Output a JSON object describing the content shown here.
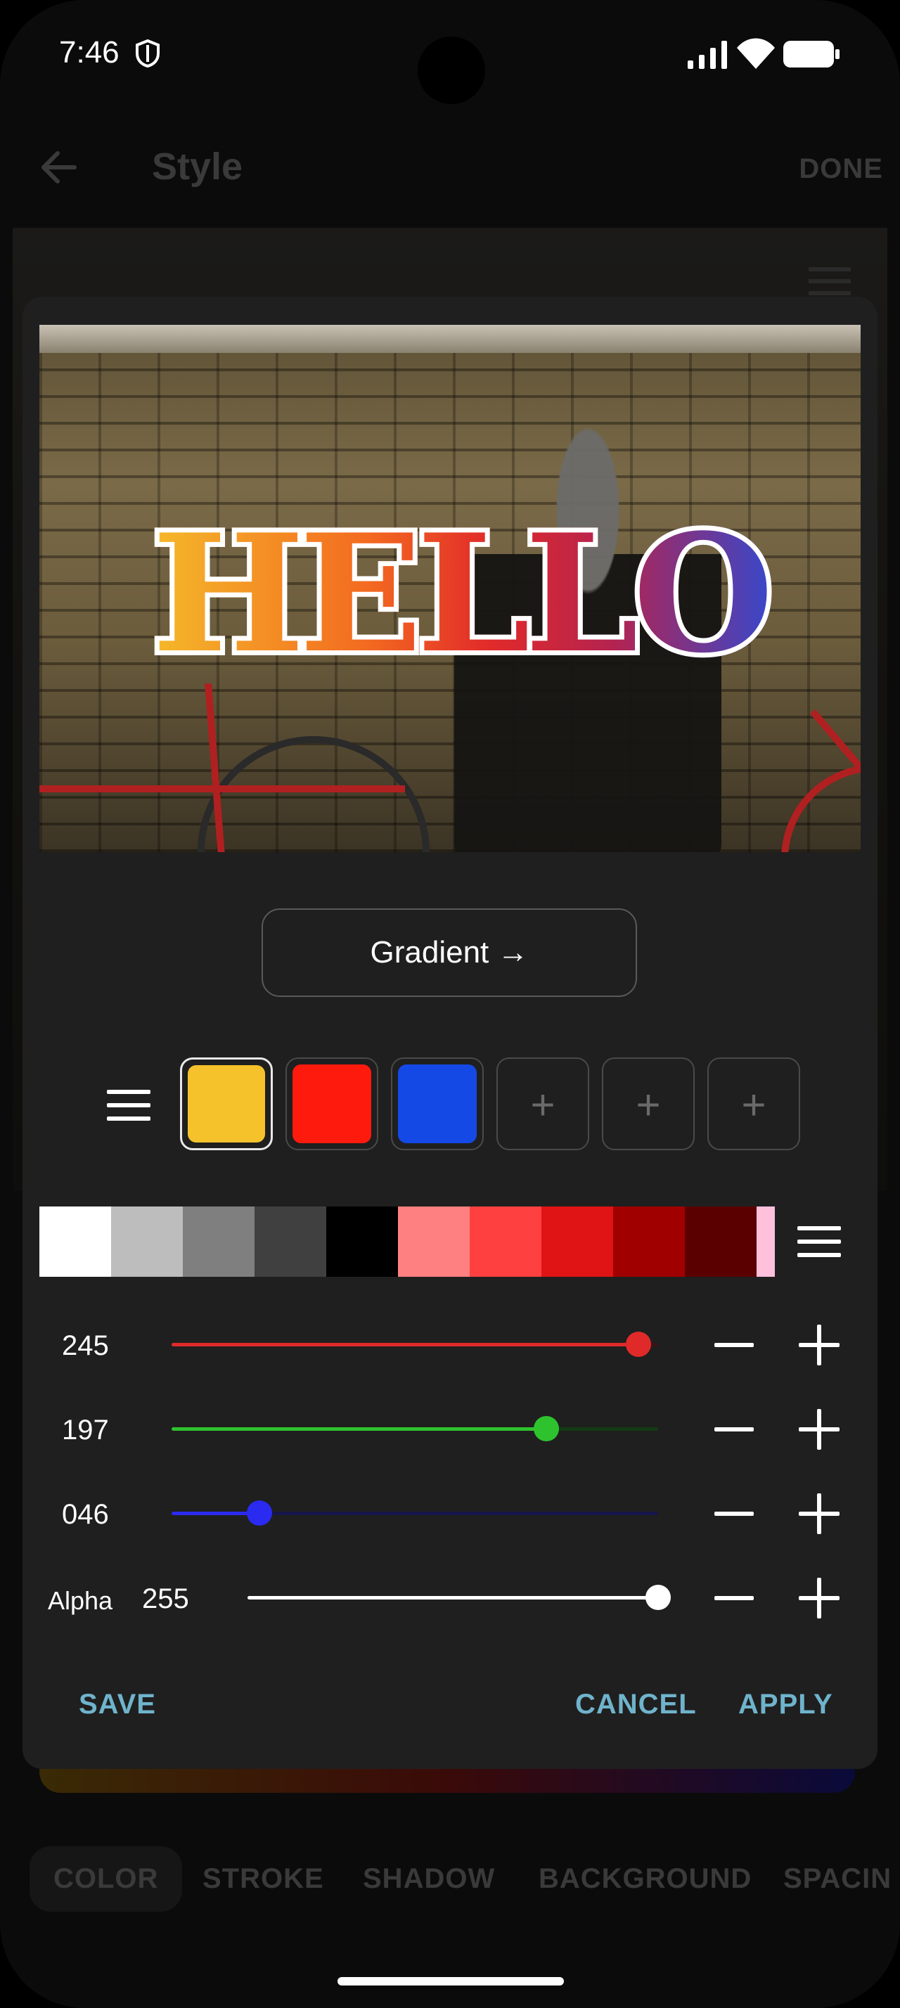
{
  "status_bar": {
    "time": "7:46"
  },
  "app_bar": {
    "title": "Style",
    "done_label": "DONE"
  },
  "preview": {
    "text": "HELLO"
  },
  "gradient_button": {
    "label": "Gradient →"
  },
  "gradient_stops": [
    {
      "color": "#F5C22B",
      "active": true
    },
    {
      "color": "#FF1A0E",
      "active": false
    },
    {
      "color": "#1449E6",
      "active": false
    }
  ],
  "add_stop_symbol": "+",
  "palette": [
    "#FFFFFF",
    "#BDBDBD",
    "#7F7F7F",
    "#404040",
    "#000000",
    "#FF8080",
    "#FF4040",
    "#E01414",
    "#A00000",
    "#5A0000",
    "#FFC0DC"
  ],
  "rgb": {
    "red": {
      "value": "245",
      "fraction": 0.96
    },
    "green": {
      "value": "197",
      "fraction": 0.77
    },
    "blue": {
      "value": "046",
      "fraction": 0.18
    }
  },
  "alpha": {
    "label": "Alpha",
    "value": "255",
    "fraction": 1.0
  },
  "actions": {
    "save": "SAVE",
    "cancel": "CANCEL",
    "apply": "APPLY"
  },
  "tabs": [
    "COLOR",
    "STROKE",
    "SHADOW",
    "BACKGROUND",
    "SPACIN"
  ]
}
